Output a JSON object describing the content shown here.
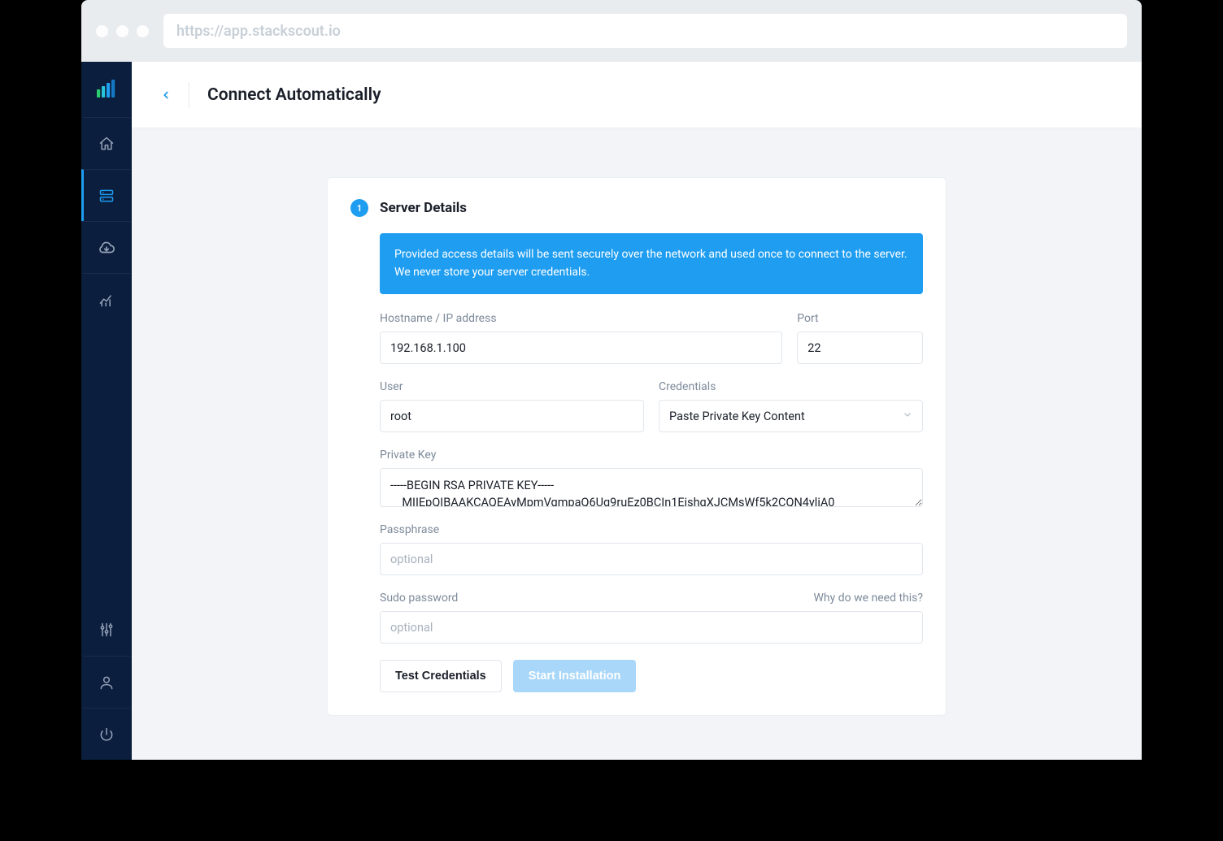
{
  "browser": {
    "url_placeholder": "https://app.stackscout.io"
  },
  "header": {
    "page_title": "Connect Automatically"
  },
  "sidebar": {
    "items": [
      {
        "name": "home"
      },
      {
        "name": "servers",
        "active": true
      },
      {
        "name": "cloud"
      },
      {
        "name": "analytics"
      }
    ],
    "bottom_items": [
      {
        "name": "settings"
      },
      {
        "name": "account"
      },
      {
        "name": "power"
      }
    ]
  },
  "card": {
    "step_number": "1",
    "title": "Server Details",
    "banner_line1": "Provided access details will be sent securely over the network and used once to connect to the server.",
    "banner_line2": "We never store your server credentials."
  },
  "form": {
    "hostname": {
      "label": "Hostname / IP address",
      "value": "192.168.1.100"
    },
    "port": {
      "label": "Port",
      "value": "22"
    },
    "user": {
      "label": "User",
      "value": "root"
    },
    "credentials": {
      "label": "Credentials",
      "selected": "Paste Private Key Content"
    },
    "private_key": {
      "label": "Private Key",
      "value": "-----BEGIN RSA PRIVATE KEY-----\n    MIIEpQIBAAKCAQEAyMpmVqmpaQ6Ug9ruEz0BCIn1EjshqXJCMsWf5k2CQN4yliA0"
    },
    "passphrase": {
      "label": "Passphrase",
      "placeholder": "optional",
      "value": ""
    },
    "sudo": {
      "label": "Sudo password",
      "hint": "Why do we need this?",
      "placeholder": "optional",
      "value": ""
    }
  },
  "actions": {
    "test": "Test Credentials",
    "start": "Start Installation"
  },
  "colors": {
    "accent": "#1e9df1",
    "sidebar": "#0b1e3d"
  }
}
